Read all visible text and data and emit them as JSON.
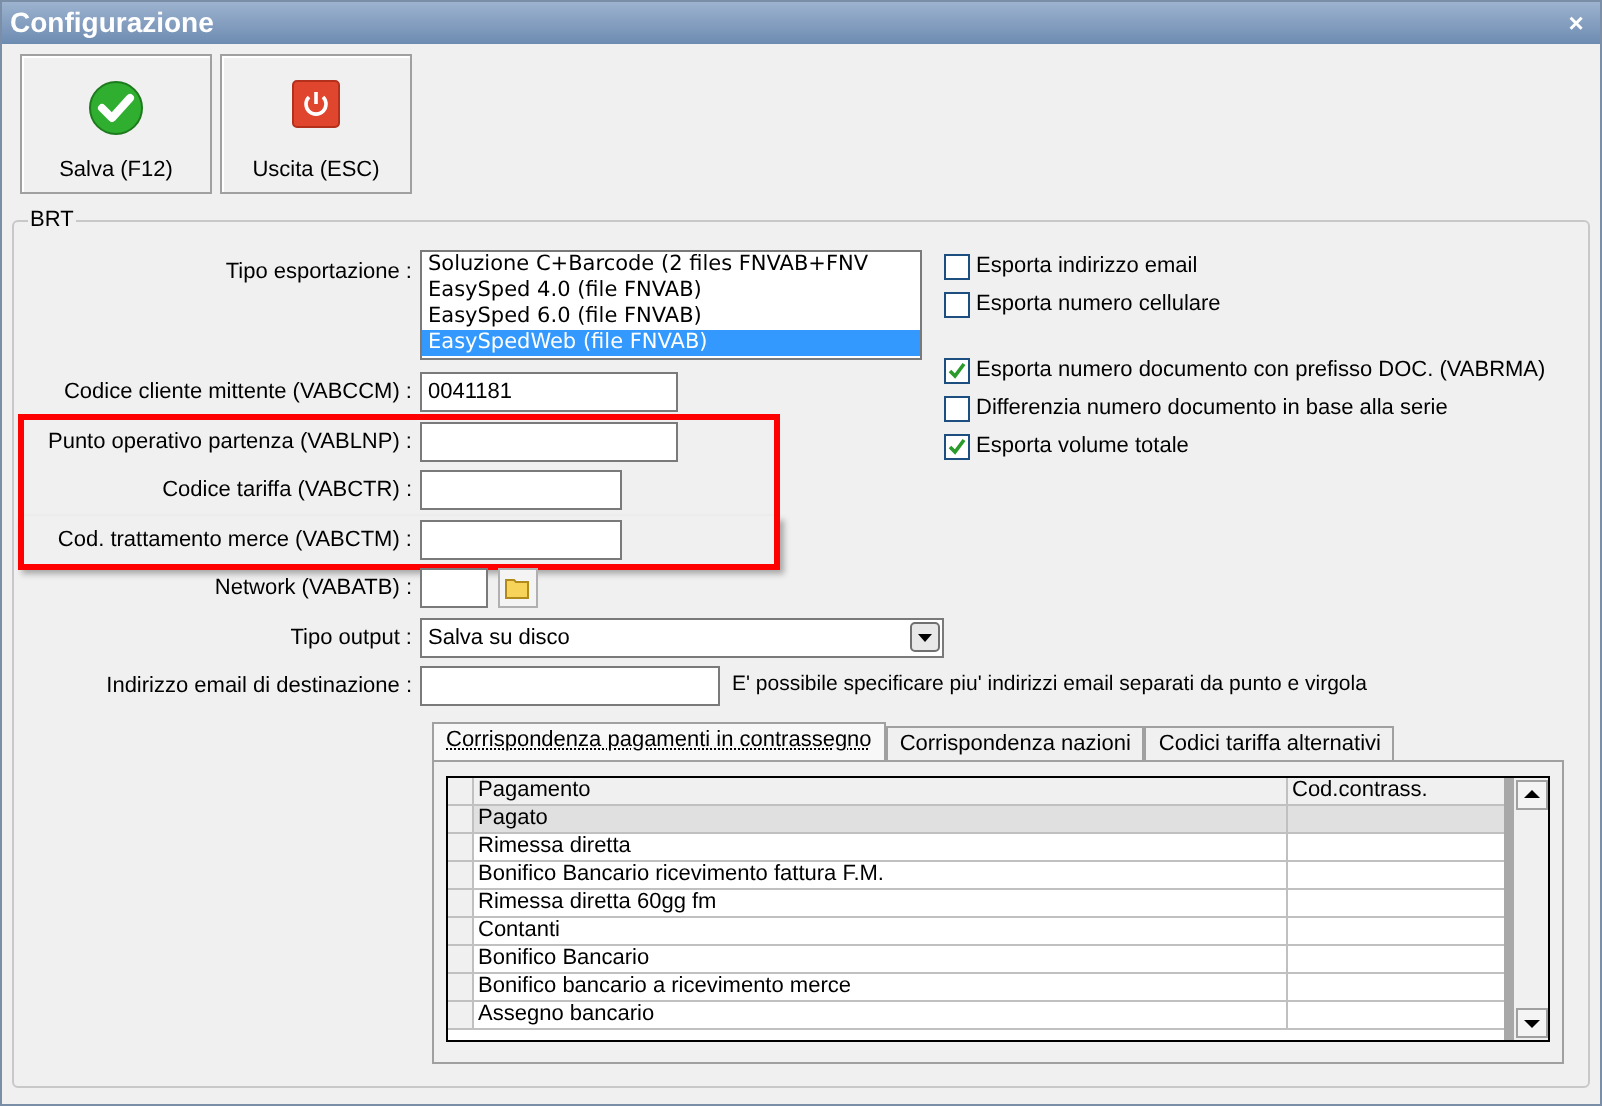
{
  "window": {
    "title": "Configurazione",
    "close": "×"
  },
  "toolbar": [
    {
      "kind": "ok",
      "label": "Salva (F12)"
    },
    {
      "kind": "exit",
      "label": "Uscita (ESC)"
    }
  ],
  "group": {
    "title": "BRT"
  },
  "export_type": {
    "label": "Tipo esportazione :",
    "options": [
      {
        "text": "Soluzione C+Barcode (2 files FNVAB+FNV",
        "selected": false
      },
      {
        "text": "EasySped 4.0 (file FNVAB)",
        "selected": false
      },
      {
        "text": "EasySped 6.0 (file FNVAB)",
        "selected": false
      },
      {
        "text": "EasySpedWeb (file FNVAB)",
        "selected": true
      }
    ]
  },
  "checkbox_groups": [
    [
      {
        "label": "Esporta indirizzo email",
        "checked": false
      },
      {
        "label": "Esporta numero cellulare",
        "checked": false
      }
    ],
    [
      {
        "label": "Esporta numero documento con prefisso DOC. (VABRMA)",
        "checked": true
      },
      {
        "label": "Differenzia numero documento in base alla serie",
        "checked": false
      },
      {
        "label": "Esporta volume totale",
        "checked": true
      }
    ]
  ],
  "fields": [
    {
      "kind": "text",
      "label": "Codice cliente mittente (VABCCM) :",
      "value": "0041181",
      "highlighted": false
    },
    {
      "kind": "text",
      "label": "Punto operativo partenza (VABLNP) :",
      "highlighted": true
    },
    {
      "kind": "text",
      "label": "Codice tariffa (VABCTR) :",
      "highlighted": true
    },
    {
      "kind": "text",
      "label": "Cod. trattamento merce (VABCTM) :",
      "highlighted": true
    },
    {
      "kind": "browse",
      "label": "Network (VABATB) :",
      "highlighted": false
    },
    {
      "kind": "dropdown",
      "label": "Tipo output :",
      "value": "Salva su disco",
      "highlighted": false
    },
    {
      "kind": "text",
      "label": "Indirizzo email di destinazione :",
      "note": "E' possibile specificare piu' indirizzi email separati da punto e virgola",
      "highlighted": false
    }
  ],
  "tabs": [
    {
      "label": "Corrispondenza pagamenti in contrassegno",
      "selected": true
    },
    {
      "label": "Corrispondenza nazioni",
      "selected": false
    },
    {
      "label": "Codici tariffa alternativi",
      "selected": false
    }
  ],
  "table": {
    "columns": [
      "Pagamento",
      "Cod.contrass."
    ],
    "rows": [
      {
        "cells": [
          "Pagato"
        ],
        "selected": true
      },
      {
        "cells": [
          "Rimessa diretta"
        ],
        "selected": false
      },
      {
        "cells": [
          "Bonifico Bancario ricevimento fattura F.M."
        ],
        "selected": false
      },
      {
        "cells": [
          "Rimessa diretta 60gg fm"
        ],
        "selected": false
      },
      {
        "cells": [
          "Contanti"
        ],
        "selected": false
      },
      {
        "cells": [
          "Bonifico Bancario"
        ],
        "selected": false
      },
      {
        "cells": [
          "Bonifico bancario a ricevimento merce"
        ],
        "selected": false
      },
      {
        "cells": [
          "Assegno bancario"
        ],
        "selected": false
      }
    ]
  }
}
